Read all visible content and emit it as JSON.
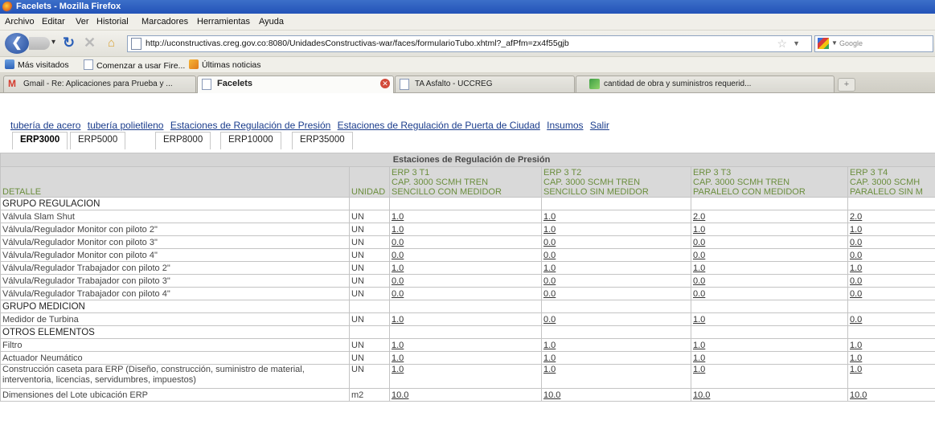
{
  "window": {
    "title": "Facelets - Mozilla Firefox"
  },
  "menu": [
    "Archivo",
    "Editar",
    "Ver",
    "Historial",
    "Marcadores",
    "Herramientas",
    "Ayuda"
  ],
  "navbar": {
    "url": "http://uconstructivas.creg.gov.co:8080/UnidadesConstructivas-war/faces/formularioTubo.xhtml?_afPfm=zx4f55gjb",
    "search_placeholder": "Google"
  },
  "bookmarks": [
    "Más visitados",
    "Comenzar a usar Fire...",
    "Últimas noticias"
  ],
  "tabs": [
    {
      "label": "Gmail - Re: Aplicaciones para Prueba y ...",
      "active": false
    },
    {
      "label": "Facelets",
      "active": true
    },
    {
      "label": "TA Asfalto - UCCREG",
      "active": false
    },
    {
      "label": "cantidad de obra y suministros requerid...",
      "active": false
    }
  ],
  "page": {
    "links": [
      "tubería de acero",
      "tubería polietileno",
      "Estaciones de Regulación de Presión",
      "Estaciones de Regulación de Puerta de Ciudad",
      "Insumos",
      "Salir"
    ],
    "subtabs": [
      {
        "label": "ERP3000",
        "active": true
      },
      {
        "label": "ERP5000",
        "active": false
      },
      {
        "label": "ERP8000",
        "active": false
      },
      {
        "label": "ERP10000",
        "active": false
      },
      {
        "label": "ERP35000",
        "active": false
      }
    ],
    "table": {
      "caption": "Estaciones de Regulación de Presión",
      "col_detalle": "DETALLE",
      "col_unidad": "UNIDAD",
      "columns": [
        [
          "ERP 3 T1",
          "CAP. 3000 SCMH TREN",
          "SENCILLO CON MEDIDOR"
        ],
        [
          "ERP 3 T2",
          "CAP. 3000 SCMH TREN",
          "SENCILLO SIN MEDIDOR"
        ],
        [
          "ERP 3 T3",
          "CAP. 3000 SCMH TREN",
          "PARALELO CON MEDIDOR"
        ],
        [
          "ERP 3 T4",
          "CAP. 3000 SCMH",
          "PARALELO SIN M"
        ]
      ],
      "rows": [
        {
          "group": true,
          "detalle": "GRUPO REGULACION"
        },
        {
          "detalle": "Válvula Slam Shut",
          "unidad": "UN",
          "values": [
            "1.0",
            "1.0",
            "2.0",
            "2.0"
          ]
        },
        {
          "detalle": "Válvula/Regulador Monitor con piloto 2\"",
          "unidad": "UN",
          "values": [
            "1.0",
            "1.0",
            "1.0",
            "1.0"
          ]
        },
        {
          "detalle": "Válvula/Regulador Monitor con piloto 3\"",
          "unidad": "UN",
          "values": [
            "0.0",
            "0.0",
            "0.0",
            "0.0"
          ]
        },
        {
          "detalle": "Válvula/Regulador Monitor con piloto 4\"",
          "unidad": "UN",
          "values": [
            "0.0",
            "0.0",
            "0.0",
            "0.0"
          ]
        },
        {
          "detalle": "Válvula/Regulador Trabajador con piloto 2\"",
          "unidad": "UN",
          "values": [
            "1.0",
            "1.0",
            "1.0",
            "1.0"
          ]
        },
        {
          "detalle": "Válvula/Regulador Trabajador con piloto 3\"",
          "unidad": "UN",
          "values": [
            "0.0",
            "0.0",
            "0.0",
            "0.0"
          ]
        },
        {
          "detalle": "Válvula/Regulador Trabajador con piloto 4\"",
          "unidad": "UN",
          "values": [
            "0.0",
            "0.0",
            "0.0",
            "0.0"
          ]
        },
        {
          "group": true,
          "detalle": "GRUPO MEDICION"
        },
        {
          "detalle": "Medidor de Turbina",
          "unidad": "UN",
          "values": [
            "1.0",
            "0.0",
            "1.0",
            "0.0"
          ]
        },
        {
          "group": true,
          "detalle": "OTROS ELEMENTOS"
        },
        {
          "detalle": "Filtro",
          "unidad": "UN",
          "values": [
            "1.0",
            "1.0",
            "1.0",
            "1.0"
          ]
        },
        {
          "detalle": "Actuador Neumático",
          "unidad": "UN",
          "values": [
            "1.0",
            "1.0",
            "1.0",
            "1.0"
          ]
        },
        {
          "detalle": "Construcción caseta para ERP (Diseño, construcción, suministro de material, interventoria, licencias, servidumbres, impuestos)",
          "unidad": "UN",
          "values": [
            "1.0",
            "1.0",
            "1.0",
            "1.0"
          ],
          "tall": true
        },
        {
          "detalle": "Dimensiones del Lote ubicación ERP",
          "unidad": "m2",
          "values": [
            "10.0",
            "10.0",
            "10.0",
            "10.0"
          ]
        }
      ]
    }
  },
  "colors": {
    "titlebar": "#2a5bbf",
    "link": "#1a3c8c",
    "header_text": "#6b8e3e",
    "header_bg": "#d9d9d9"
  }
}
